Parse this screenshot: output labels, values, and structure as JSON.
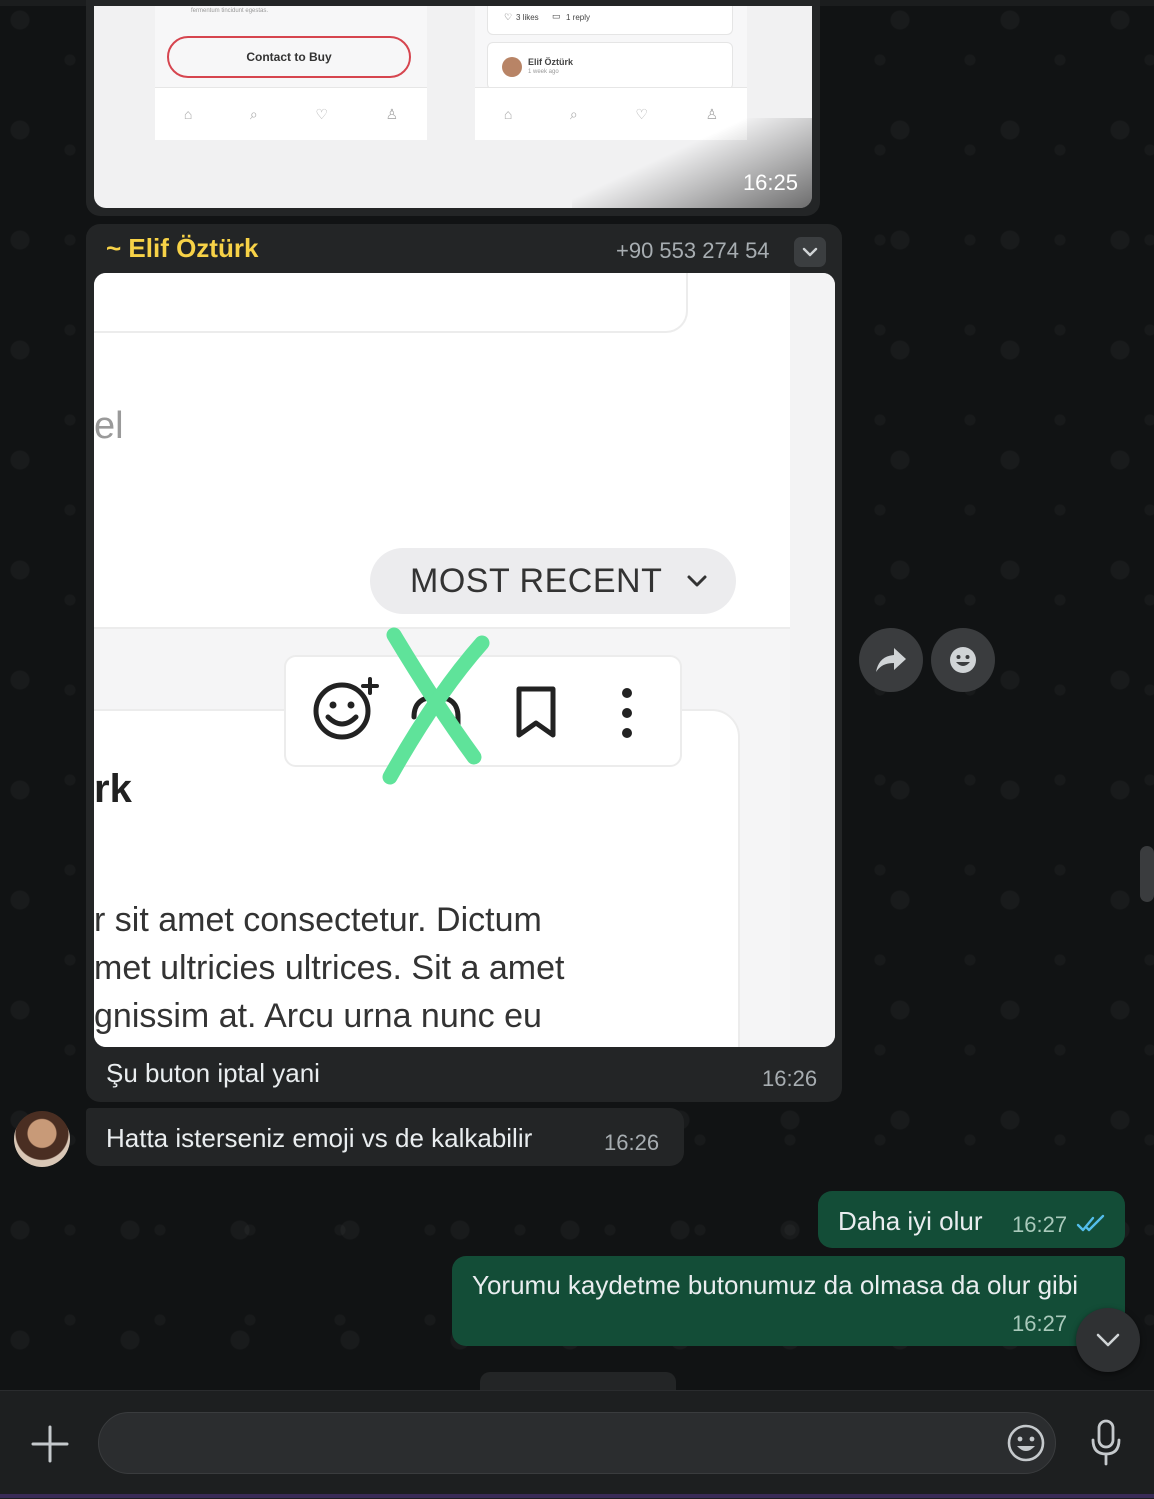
{
  "messages": {
    "m1": {
      "time": "16:25",
      "shot": {
        "contact_label": "Contact to Buy",
        "faded_text": "fermentum tincidunt egestas.",
        "likes": "3 likes",
        "replies": "1 reply",
        "commenter": "Elif Öztürk",
        "commenter_time": "1 week ago"
      }
    },
    "m2": {
      "sender": "~ Elif Öztürk",
      "phone": "+90 553 274 54",
      "shot": {
        "partial_label": "el",
        "sort_label": "MOST RECENT",
        "author_fragment": "rk",
        "line1": "r sit amet consectetur. Dictum",
        "line2": "met ultricies ultrices. Sit a amet",
        "line3": "gnissim at. Arcu urna nunc eu"
      },
      "caption": "Şu buton iptal yani",
      "time": "16:26"
    },
    "m3": {
      "text": "Hatta isterseniz emoji vs de kalkabilir",
      "time": "16:26"
    },
    "m4": {
      "text": "Daha iyi olur",
      "time": "16:27"
    },
    "m5": {
      "text": "Yorumu kaydetme butonumuz da olmasa da olur gibi",
      "time": "16:27"
    }
  },
  "colors": {
    "sender_name": "#f7d247",
    "outgoing_bubble": "#134d37",
    "incoming_bubble": "#232526",
    "read_ticks": "#53bdeb",
    "x_mark": "#5fe39a"
  },
  "icons": [
    "share-icon",
    "emoji-reaction-icon",
    "chevron-down-icon",
    "plus-icon",
    "emoji-icon",
    "mic-icon",
    "double-check-icon"
  ]
}
